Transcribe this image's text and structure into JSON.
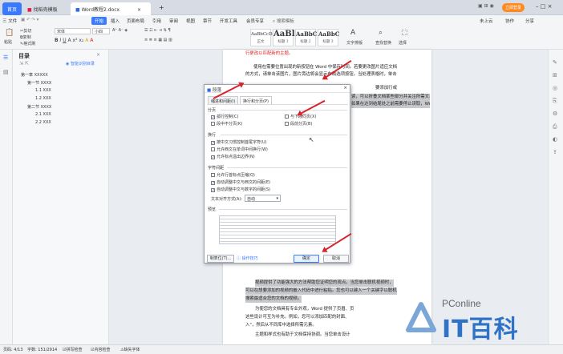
{
  "tabs": {
    "home": "首页",
    "tab1": "找稻壳模板",
    "tab2": "Word教程2.docx",
    "plus": "+"
  },
  "window": {
    "login": "立即登录"
  },
  "menu": {
    "file": "三 文件",
    "items": [
      "开始",
      "插入",
      "页面布局",
      "引用",
      "审阅",
      "视图",
      "章节",
      "开发工具",
      "会员专享"
    ],
    "search": "搜索模板",
    "right": [
      "未上云",
      "协作",
      "分享"
    ]
  },
  "toolbar": {
    "paste": "粘贴",
    "cut": "剪切",
    "copy": "复制",
    "format_painter": "格式刷",
    "font": "宋体",
    "size": "小四",
    "styles": [
      {
        "sample": "AaBbCcDd",
        "label": "正文"
      },
      {
        "sample": "AaBl",
        "label": "标题 1"
      },
      {
        "sample": "AaBbC",
        "label": "标题 2"
      },
      {
        "sample": "AaBbC",
        "label": "标题 3"
      }
    ],
    "text_tool": "文字排版",
    "find_replace": "查找替换",
    "select": "选择"
  },
  "toc": {
    "title": "目录",
    "smart": "智能识别目录",
    "items": [
      "第一章 XXXXX",
      "第一节 XXXX",
      "1.1 XXX",
      "1.2 XXX",
      "第二节 XXXX",
      "2.1 XXX",
      "2.2 XXX"
    ]
  },
  "document": {
    "top_lines": [
      "行更改以匹配新的主题。",
      "使用在需要位置出现的新按钮在 Word 中保存时间。若要更改图片适应文档",
      "的方式，请单击该图片，图片旁边将会显示布局选项按钮。当处理表格时，单击"
    ],
    "right_lines": [
      "要添加行或",
      "读，可以折叠文档某些部分并关注所需文本。",
      "如果在达到结尾处之前需要停止读取，Word 会记住您的停止位置 - 即使在另一"
    ],
    "bottom_lines": [
      "视频提供了功能强大的方法帮助您证明您的观点。当您单击联机视频时，",
      "可以在想要添加的视频的嵌入代码中进行粘贴。您也可以键入一个关键字以联机",
      "搜索最适合您的文档的视频。",
      "为使您的文档具有专业外观，Word 提供了页眉、页",
      "这些设计可互为补充。例如，您可以添加匹配的封面、",
      "入\"，然后从不同库中选择所需元素。",
      "主题和样式也有助于文档保持协调。当您单击设计"
    ]
  },
  "dialog": {
    "title": "段落",
    "tabs": [
      "缩进和间距(I)",
      "换行和分页(P)"
    ],
    "pagination": {
      "label": "分页",
      "options": [
        {
          "text": "孤行控制(C)",
          "checked": true
        },
        {
          "text": "与下段同页(X)",
          "checked": false
        },
        {
          "text": "段中不分页(K)",
          "checked": false
        },
        {
          "text": "段前分页(B)",
          "checked": false
        }
      ]
    },
    "linebreak": {
      "label": "换行",
      "options": [
        {
          "text": "按中文习惯控制首尾字符(U)",
          "checked": true
        },
        {
          "text": "允许西文在单词中间换行(W)",
          "checked": false
        },
        {
          "text": "允许标点溢出边界(N)",
          "checked": true
        }
      ]
    },
    "spacing": {
      "label": "字符间距",
      "options": [
        {
          "text": "允许行首标点压缩(Q)",
          "checked": false
        },
        {
          "text": "自动调整中文与西文的间距(E)",
          "checked": true
        },
        {
          "text": "自动调整中文与数字的间距(S)",
          "checked": true
        }
      ],
      "align_label": "文本对齐方式(A):",
      "align_value": "自动"
    },
    "preview": {
      "label": "预览"
    },
    "buttons": {
      "tabs": "制表位(T)...",
      "tips": "操作技巧",
      "ok": "确定",
      "cancel": "取消"
    }
  },
  "status": {
    "page": "页码: 4/13",
    "words": "字数: 151/2914",
    "spell": "拼写检查",
    "content": "内容检查",
    "missing_font": "缺失字体"
  },
  "watermark": {
    "brand": "PConline",
    "name": "IT百科"
  },
  "colors": {
    "accent": "#3a7afe",
    "arrow": "#d8232a",
    "highlight": "#c7c9cc"
  }
}
